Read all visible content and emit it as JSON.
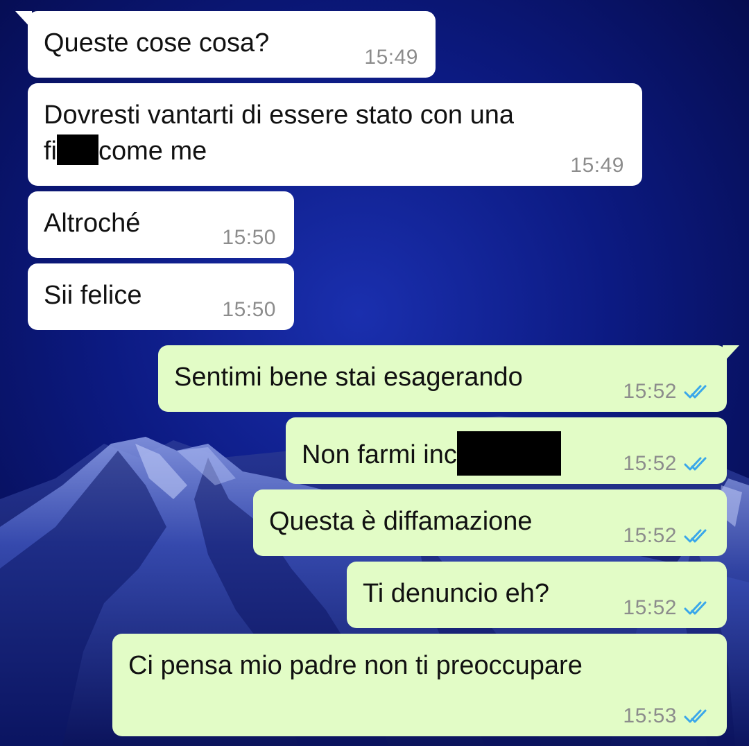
{
  "colors": {
    "incoming_bubble": "#ffffff",
    "outgoing_bubble": "#e2fcc6",
    "timestamp": "#8c8c8c",
    "read_ticks": "#3aa7ea",
    "wallpaper": "#050b4a",
    "redaction": "#000000"
  },
  "icons": {
    "read_receipt": "double-check-icon"
  },
  "messages": [
    {
      "direction": "incoming",
      "text": "Queste cose cosa?",
      "time": "15:49"
    },
    {
      "direction": "incoming",
      "line1": "Dovresti vantarti di essere stato con una",
      "line2_start": "fi",
      "line2_end": "come me",
      "redacted": true,
      "time": "15:49"
    },
    {
      "direction": "incoming",
      "text": "Altroché",
      "time": "15:50"
    },
    {
      "direction": "incoming",
      "text": "Sii felice",
      "time": "15:50"
    },
    {
      "direction": "outgoing",
      "text": "Sentimi bene stai esagerando",
      "time": "15:52",
      "status": "read"
    },
    {
      "direction": "outgoing",
      "text": "Non farmi inc",
      "redacted": true,
      "time": "15:52",
      "status": "read"
    },
    {
      "direction": "outgoing",
      "text": "Questa è diffamazione",
      "time": "15:52",
      "status": "read"
    },
    {
      "direction": "outgoing",
      "text": "Ti denuncio eh?",
      "time": "15:52",
      "status": "read"
    },
    {
      "direction": "outgoing",
      "text": "Ci pensa mio padre non ti preoccupare",
      "time": "15:53",
      "status": "read"
    }
  ]
}
